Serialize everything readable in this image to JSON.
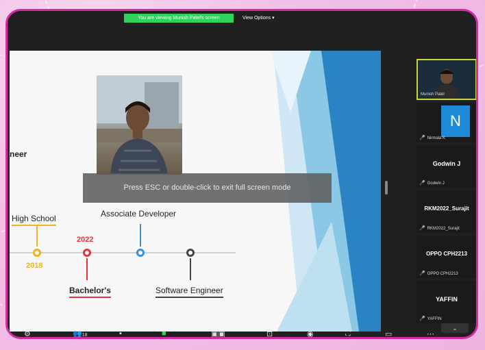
{
  "meeting": {
    "viewing_banner": "You are viewing Munish Patel's screen",
    "view_options": "View Options",
    "view_options_caret": "▾",
    "fullscreen_notice": "Press ESC or double-click to exit full screen mode"
  },
  "slide": {
    "role_fragment": "neer",
    "timeline": [
      {
        "label": "High School",
        "year": "2018"
      },
      {
        "label": "Bachelor's",
        "year": "2022"
      },
      {
        "label": "Associate Developer"
      },
      {
        "label": "Software Engineer"
      }
    ]
  },
  "participants": [
    {
      "name": "Munish Patel",
      "type": "video"
    },
    {
      "name": "Nirmala K",
      "initial": "N"
    },
    {
      "name": "Godwin J",
      "display": "Godwin J"
    },
    {
      "name": "RKM2022_Surajit",
      "display": "RKM2022_Surajit"
    },
    {
      "name": "OPPO CPH2213",
      "display": "OPPO CPH2213"
    },
    {
      "name": "YAFFIN",
      "display": "YAFFIN"
    }
  ],
  "toolbar": {
    "participants_count": "18",
    "icons": [
      "mic-icon",
      "participants-icon",
      "chat-icon",
      "share-icon",
      "record-icon",
      "cc-icon",
      "reactions-icon",
      "fullscreen-icon",
      "screen-icon",
      "more-icon"
    ]
  },
  "colors": {
    "frame": "#d52aa0",
    "banner": "#2fd35b",
    "year_2018": "#f2b21d",
    "year_2022": "#e8303e",
    "avatar_blue": "#1f8bd8",
    "mic_muted": "#e12b2b"
  }
}
